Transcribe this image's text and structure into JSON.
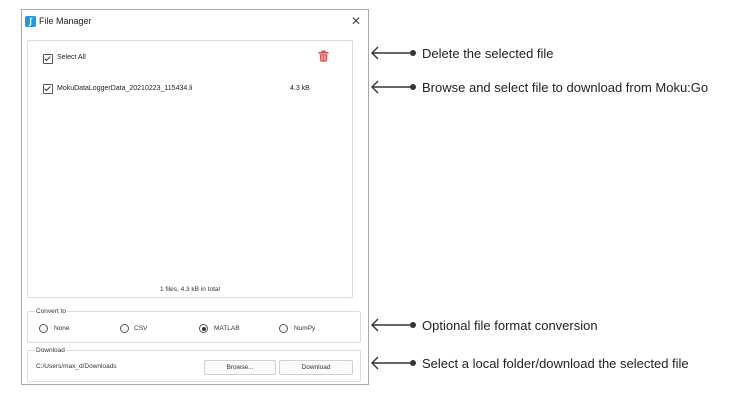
{
  "window": {
    "title": "File Manager",
    "close_glyph": "✕",
    "app_icon": "moku-app-icon"
  },
  "files": {
    "select_all_label": "Select All",
    "select_all_checked": true,
    "items": [
      {
        "name": "MokuDataLoggerData_20210223_115434.li",
        "size": "4.3 kB",
        "checked": true
      }
    ],
    "summary": "1 files, 4.3 kB in total",
    "delete_icon_color": "#e04a4a"
  },
  "convert": {
    "title": "Convert to",
    "options": [
      "None",
      "CSV",
      "MATLAB",
      "NumPy"
    ],
    "selected": "MATLAB"
  },
  "download": {
    "title": "Download",
    "path": "C:/Users/max_d/Downloads",
    "browse_label": "Browse...",
    "download_label": "Download"
  },
  "annotations": [
    "Delete the selected file",
    "Browse and select file to download from Moku:Go",
    "Optional file format conversion",
    "Select a local folder/download the selected file"
  ]
}
